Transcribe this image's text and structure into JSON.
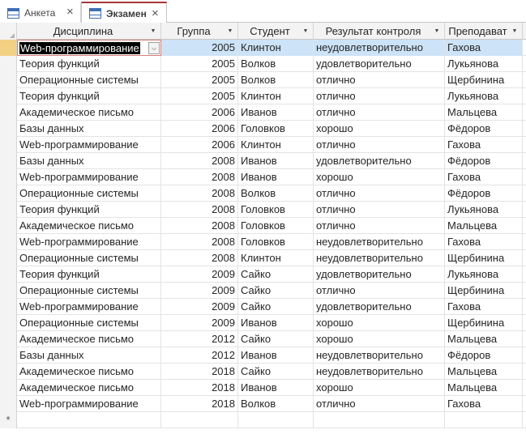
{
  "tabs": [
    {
      "label": "Анкета",
      "active": false,
      "icon": "table-icon"
    },
    {
      "label": "Экзамен",
      "active": true,
      "icon": "table-icon"
    }
  ],
  "columns": [
    "Дисциплина",
    "Группа",
    "Студент",
    "Результат контроля",
    "Преподават"
  ],
  "rows": [
    [
      "Web-программирование",
      "2005",
      "Клинтон",
      "неудовлетворительно",
      "Гахова"
    ],
    [
      "Теория функций",
      "2005",
      "Волков",
      "удовлетворительно",
      "Лукьянова"
    ],
    [
      "Операционные системы",
      "2005",
      "Волков",
      "отлично",
      "Щербинина"
    ],
    [
      "Теория функций",
      "2005",
      "Клинтон",
      "отлично",
      "Лукьянова"
    ],
    [
      "Академическое письмо",
      "2006",
      "Иванов",
      "отлично",
      "Мальцева"
    ],
    [
      "Базы данных",
      "2006",
      "Головков",
      "хорошо",
      "Фёдоров"
    ],
    [
      "Web-программирование",
      "2006",
      "Клинтон",
      "отлично",
      "Гахова"
    ],
    [
      "Базы данных",
      "2008",
      "Иванов",
      "удовлетворительно",
      "Фёдоров"
    ],
    [
      "Web-программирование",
      "2008",
      "Иванов",
      "хорошо",
      "Гахова"
    ],
    [
      "Операционные системы",
      "2008",
      "Волков",
      "отлично",
      "Фёдоров"
    ],
    [
      "Теория функций",
      "2008",
      "Головков",
      "отлично",
      "Лукьянова"
    ],
    [
      "Академическое письмо",
      "2008",
      "Головков",
      "отлично",
      "Мальцева"
    ],
    [
      "Web-программирование",
      "2008",
      "Головков",
      "неудовлетворительно",
      "Гахова"
    ],
    [
      "Операционные системы",
      "2008",
      "Клинтон",
      "неудовлетворительно",
      "Щербинина"
    ],
    [
      "Теория функций",
      "2009",
      "Сайко",
      "удовлетворительно",
      "Лукьянова"
    ],
    [
      "Операционные системы",
      "2009",
      "Сайко",
      "отлично",
      "Щербинина"
    ],
    [
      "Web-программирование",
      "2009",
      "Сайко",
      "удовлетворительно",
      "Гахова"
    ],
    [
      "Операционные системы",
      "2009",
      "Иванов",
      "хорошо",
      "Щербинина"
    ],
    [
      "Академическое письмо",
      "2012",
      "Сайко",
      "хорошо",
      "Мальцева"
    ],
    [
      "Базы данных",
      "2012",
      "Иванов",
      "неудовлетворительно",
      "Фёдоров"
    ],
    [
      "Академическое письмо",
      "2018",
      "Сайко",
      "неудовлетворительно",
      "Мальцева"
    ],
    [
      "Академическое письмо",
      "2018",
      "Иванов",
      "хорошо",
      "Мальцева"
    ],
    [
      "Web-программирование",
      "2018",
      "Волков",
      "отлично",
      "Гахова"
    ]
  ],
  "current_row": 0,
  "new_row_marker": "*",
  "colors": {
    "accent_tab": "#a4373a",
    "selected_row": "#cde3f7",
    "record_selector_current": "#f2d084"
  }
}
